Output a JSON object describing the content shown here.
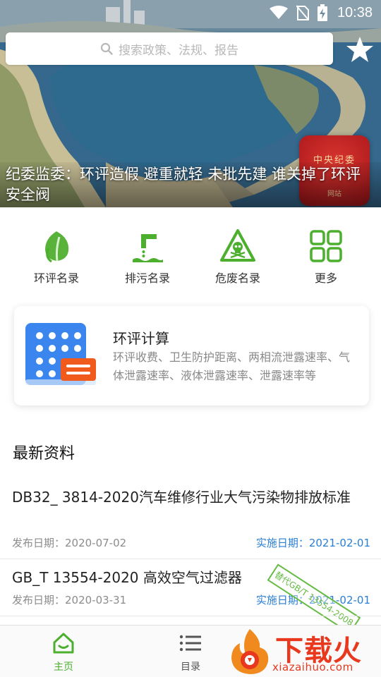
{
  "status_bar": {
    "time": "10:38",
    "icons": [
      "wifi-icon",
      "no-sim-icon",
      "battery-charging-icon"
    ]
  },
  "search": {
    "placeholder": "搜索政策、法规、报告"
  },
  "hero": {
    "headline": "纪委监委：环评造假 避重就轻 未批先建 谁关掉了环评安全阀",
    "seal_text": "中央纪委",
    "seal_sub": "网站"
  },
  "categories": [
    {
      "label": "环评名录",
      "icon": "leaf-icon"
    },
    {
      "label": "排污名录",
      "icon": "discharge-pipe-icon"
    },
    {
      "label": "危废名录",
      "icon": "hazard-skull-icon"
    },
    {
      "label": "更多",
      "icon": "grid-icon"
    }
  ],
  "calc_card": {
    "title": "环评计算",
    "description": "环评收费、卫生防护距离、两相流泄露速率、气体泄露速率、液体泄露速率、泄露速率等",
    "icon": "calculator-icon"
  },
  "latest": {
    "title": "最新资料",
    "items": [
      {
        "title": "DB32_ 3814-2020汽车维修行业大气污染物排放标准",
        "published": "发布日期：2020-07-02",
        "implemented": "实施日期：2021-02-01"
      },
      {
        "title": "GB_T 13554-2020 高效空气过滤器",
        "published": "发布日期：2020-03-31",
        "implemented": "实施日期：2021-02-01",
        "stamp": "替代GB/T 13554-2008"
      }
    ]
  },
  "bottom_nav": [
    {
      "label": "主页",
      "icon": "home-icon",
      "active": true
    },
    {
      "label": "目录",
      "icon": "list-icon",
      "active": false
    }
  ],
  "watermark": {
    "main": "下载火",
    "sub": "xiazaihuo.com"
  },
  "colors": {
    "accent_green": "#4caf2d",
    "link_blue": "#2a7fd4",
    "watermark_red": "#e8391f"
  }
}
